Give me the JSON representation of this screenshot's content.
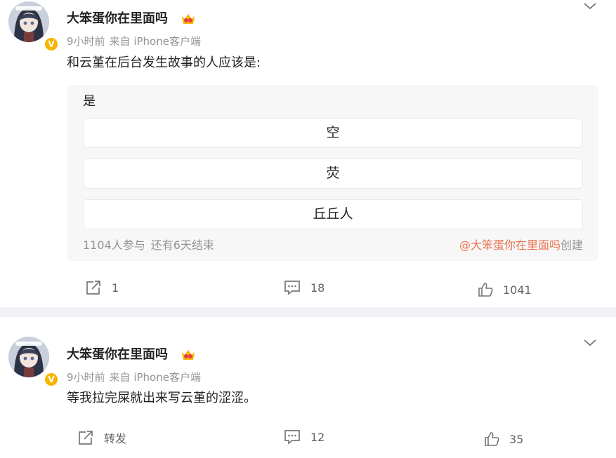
{
  "posts": [
    {
      "username": "大笨蛋你在里面吗",
      "time": "9小时前",
      "source": "来自 iPhone客户端",
      "content": "和云堇在后台发生故事的人应该是:",
      "poll": {
        "question": "是",
        "options": [
          "空",
          "荧",
          "丘丘人"
        ],
        "participants": "1104人参与",
        "remaining": "还有6天结束",
        "creator_link": "@大笨蛋你在里面吗",
        "creator_suffix": "创建"
      },
      "actions": {
        "repost": "1",
        "comment": "18",
        "like": "1041"
      }
    },
    {
      "username": "大笨蛋你在里面吗",
      "time": "9小时前",
      "source": "来自 iPhone客户端",
      "content": "等我拉完屎就出来写云堇的涩涩。",
      "actions": {
        "repost": "转发",
        "comment": "12",
        "like": "35"
      }
    }
  ],
  "icons": {
    "verified": "v-verified-badge-icon",
    "crown": "crown-icon",
    "more": "chevron-down-icon",
    "repost": "share-icon",
    "comment": "comment-icon",
    "like": "thumbs-up-icon"
  },
  "colors": {
    "accent_link": "#eb7350",
    "verified_badge": "#f7b500",
    "meta_text": "#939393",
    "divider": "#f1f2f5",
    "poll_bg": "#f7f7f7"
  }
}
